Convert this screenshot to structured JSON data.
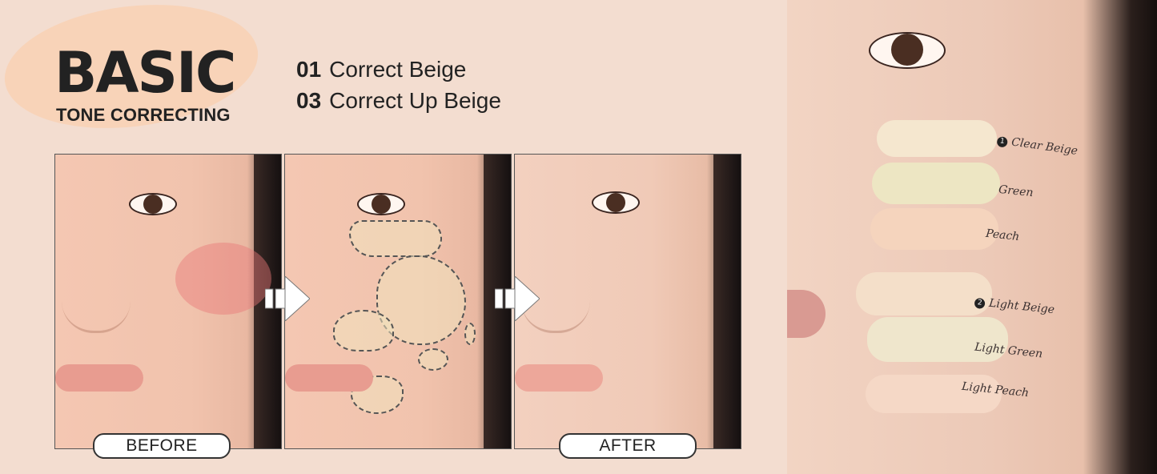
{
  "title": {
    "main": "BASIC",
    "sub": "TONE CORRECTING"
  },
  "products": [
    {
      "num": "01",
      "name": "Correct Beige"
    },
    {
      "num": "03",
      "name": "Correct Up Beige"
    }
  ],
  "labels": {
    "before": "BEFORE",
    "after": "AFTER"
  },
  "swatches": [
    {
      "num": "1",
      "name": "Clear Beige"
    },
    {
      "name": "Green"
    },
    {
      "name": "Peach"
    },
    {
      "num": "2",
      "name": "Light Beige"
    },
    {
      "name": "Light Green"
    },
    {
      "name": "Light Peach"
    }
  ],
  "colors": {
    "background": "#f3ddd0",
    "accent_blob": "#f8d3b8",
    "text": "#222222"
  }
}
